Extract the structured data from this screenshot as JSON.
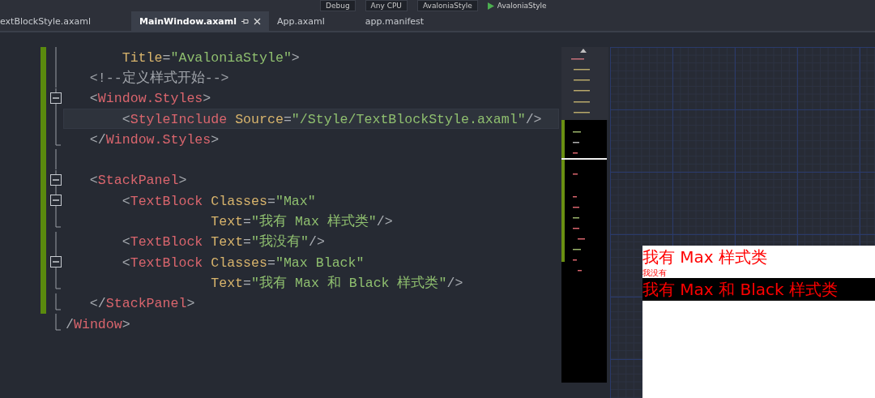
{
  "toolbar": {
    "items": [
      "Debug",
      "Any CPU",
      "AvaloniaStyle"
    ],
    "run_target": "AvaloniaStyle"
  },
  "tabs": [
    {
      "label": "extBlockStyle.axaml",
      "selected": false
    },
    {
      "label": "MainWindow.axaml",
      "selected": true
    },
    {
      "label": "App.axaml",
      "selected": false
    },
    {
      "label": "app.manifest",
      "selected": false
    }
  ],
  "code_lines": [
    {
      "kind": "line",
      "changed": true,
      "current": false,
      "tokens": [
        {
          "kind": "attr",
          "text": "       Title"
        },
        {
          "kind": "punct",
          "text": "="
        },
        {
          "kind": "value",
          "text": "\"AvaloniaStyle\""
        },
        {
          "kind": "punct",
          "text": ">"
        }
      ]
    },
    {
      "kind": "line",
      "changed": true,
      "current": false,
      "tokens": [
        {
          "kind": "comment",
          "text": "   <!--定义样式开始-->"
        }
      ]
    },
    {
      "kind": "collapse",
      "changed": true,
      "current": false,
      "tokens": [
        {
          "kind": "punct",
          "text": "   <"
        },
        {
          "kind": "tag",
          "text": "Window.Styles"
        },
        {
          "kind": "punct",
          "text": ">"
        }
      ]
    },
    {
      "kind": "line",
      "changed": true,
      "current": true,
      "tokens": [
        {
          "kind": "punct",
          "text": "       <"
        },
        {
          "kind": "tag",
          "text": "StyleInclude"
        },
        {
          "kind": "attr",
          "text": " Source"
        },
        {
          "kind": "punct",
          "text": "="
        },
        {
          "kind": "value",
          "text": "\"/Style/TextBlockStyle.axaml\""
        },
        {
          "kind": "punct",
          "text": "/>"
        }
      ]
    },
    {
      "kind": "end",
      "changed": true,
      "current": false,
      "tokens": [
        {
          "kind": "punct",
          "text": "   </"
        },
        {
          "kind": "tag",
          "text": "Window.Styles"
        },
        {
          "kind": "punct",
          "text": ">"
        }
      ]
    },
    {
      "kind": "line",
      "changed": true,
      "current": false
    },
    {
      "kind": "collapse",
      "changed": true,
      "current": false,
      "tokens": [
        {
          "kind": "punct",
          "text": "   <"
        },
        {
          "kind": "tag",
          "text": "StackPanel"
        },
        {
          "kind": "punct",
          "text": ">"
        }
      ]
    },
    {
      "kind": "collapse",
      "changed": true,
      "current": false,
      "tokens": [
        {
          "kind": "punct",
          "text": "       <"
        },
        {
          "kind": "tag",
          "text": "TextBlock"
        },
        {
          "kind": "attr",
          "text": " Classes"
        },
        {
          "kind": "punct",
          "text": "="
        },
        {
          "kind": "value",
          "text": "\"Max\""
        }
      ]
    },
    {
      "kind": "end",
      "changed": true,
      "current": false,
      "tokens": [
        {
          "kind": "attr",
          "text": "                  Text"
        },
        {
          "kind": "punct",
          "text": "="
        },
        {
          "kind": "value",
          "text": "\"我有 Max 样式类\""
        },
        {
          "kind": "punct",
          "text": "/>"
        }
      ]
    },
    {
      "kind": "line",
      "changed": true,
      "current": false,
      "tokens": [
        {
          "kind": "punct",
          "text": "       <"
        },
        {
          "kind": "tag",
          "text": "TextBlock"
        },
        {
          "kind": "attr",
          "text": " Text"
        },
        {
          "kind": "punct",
          "text": "="
        },
        {
          "kind": "value",
          "text": "\"我没有\""
        },
        {
          "kind": "punct",
          "text": "/>"
        }
      ]
    },
    {
      "kind": "collapse",
      "changed": true,
      "current": false,
      "tokens": [
        {
          "kind": "punct",
          "text": "       <"
        },
        {
          "kind": "tag",
          "text": "TextBlock"
        },
        {
          "kind": "attr",
          "text": " Classes"
        },
        {
          "kind": "punct",
          "text": "="
        },
        {
          "kind": "value",
          "text": "\"Max Black\""
        }
      ]
    },
    {
      "kind": "end",
      "changed": true,
      "current": false,
      "tokens": [
        {
          "kind": "attr",
          "text": "                  Text"
        },
        {
          "kind": "punct",
          "text": "="
        },
        {
          "kind": "value",
          "text": "\"我有 Max 和 Black 样式类\""
        },
        {
          "kind": "punct",
          "text": "/>"
        }
      ]
    },
    {
      "kind": "end",
      "changed": true,
      "current": false,
      "tokens": [
        {
          "kind": "punct",
          "text": "   </"
        },
        {
          "kind": "tag",
          "text": "StackPanel"
        },
        {
          "kind": "punct",
          "text": ">"
        }
      ]
    },
    {
      "kind": "end",
      "changed": false,
      "current": false,
      "tokens": [
        {
          "kind": "punct",
          "text": "/"
        },
        {
          "kind": "tag",
          "text": "Window"
        },
        {
          "kind": "punct",
          "text": ">"
        }
      ]
    }
  ],
  "preview": {
    "texts": [
      {
        "kind": "max",
        "text": "我有 Max 样式类"
      },
      {
        "kind": "plain",
        "text": "我没有"
      },
      {
        "kind": "max-black",
        "text": "我有 Max 和 Black 样式类"
      }
    ]
  }
}
